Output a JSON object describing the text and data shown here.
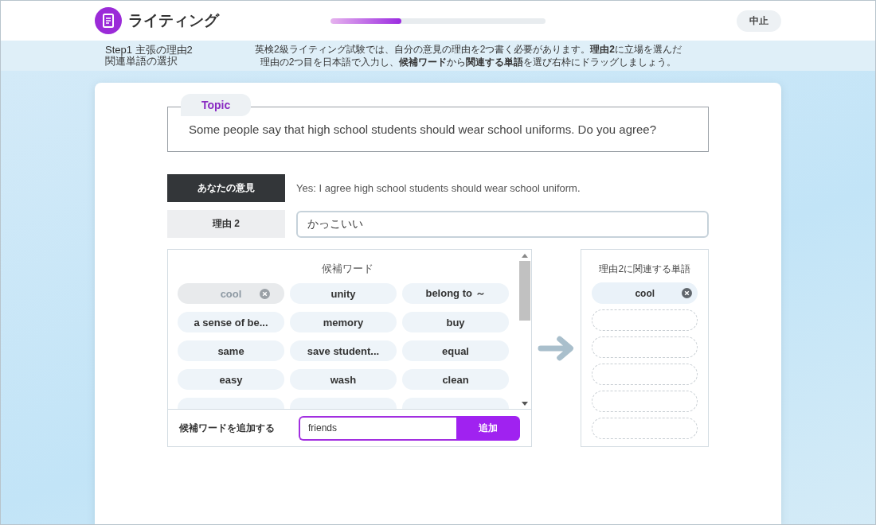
{
  "header": {
    "title": "ライティング",
    "progress": {
      "level": 0.33
    },
    "quit_button": "中止"
  },
  "step": {
    "title_lines": [
      "Step1 主張の理由2",
      "関連単語の選択"
    ],
    "instructions": [
      "英検2級ライティング試験では、自分の意見の理由を2つ書く必要があります。**理由2**に立場を選んだ",
      "理由の2つ目を日本語で入力し、**候補ワード**から**関連する単語**を選び右枠にドラッグしましょう。"
    ]
  },
  "topic": {
    "label": "Topic",
    "text": "Some people say that high school students should wear school uniforms. Do you agree?"
  },
  "opinion": {
    "label": "あなたの意見",
    "text": "Yes: I agree high school students should wear school uniform."
  },
  "reason": {
    "label": "理由 2",
    "value": "かっこいい"
  },
  "candidates": {
    "title": "候補ワード",
    "words": [
      {
        "text": "cool",
        "used": true
      },
      {
        "text": "unity",
        "used": false
      },
      {
        "text": "belong to ～",
        "used": false
      },
      {
        "text": "a sense of be...",
        "used": false
      },
      {
        "text": "memory",
        "used": false
      },
      {
        "text": "buy",
        "used": false
      },
      {
        "text": "same",
        "used": false
      },
      {
        "text": "save student...",
        "used": false
      },
      {
        "text": "equal",
        "used": false
      },
      {
        "text": "easy",
        "used": false
      },
      {
        "text": "wash",
        "used": false
      },
      {
        "text": "clean",
        "used": false
      }
    ],
    "add_label": "候補ワードを追加する",
    "add_value": "friends",
    "add_button": "追加"
  },
  "related": {
    "title": "理由2に関連する単語",
    "slots": [
      {
        "filled": true,
        "word": "cool"
      },
      {
        "filled": false
      },
      {
        "filled": false
      },
      {
        "filled": false
      },
      {
        "filled": false
      },
      {
        "filled": false
      }
    ]
  }
}
